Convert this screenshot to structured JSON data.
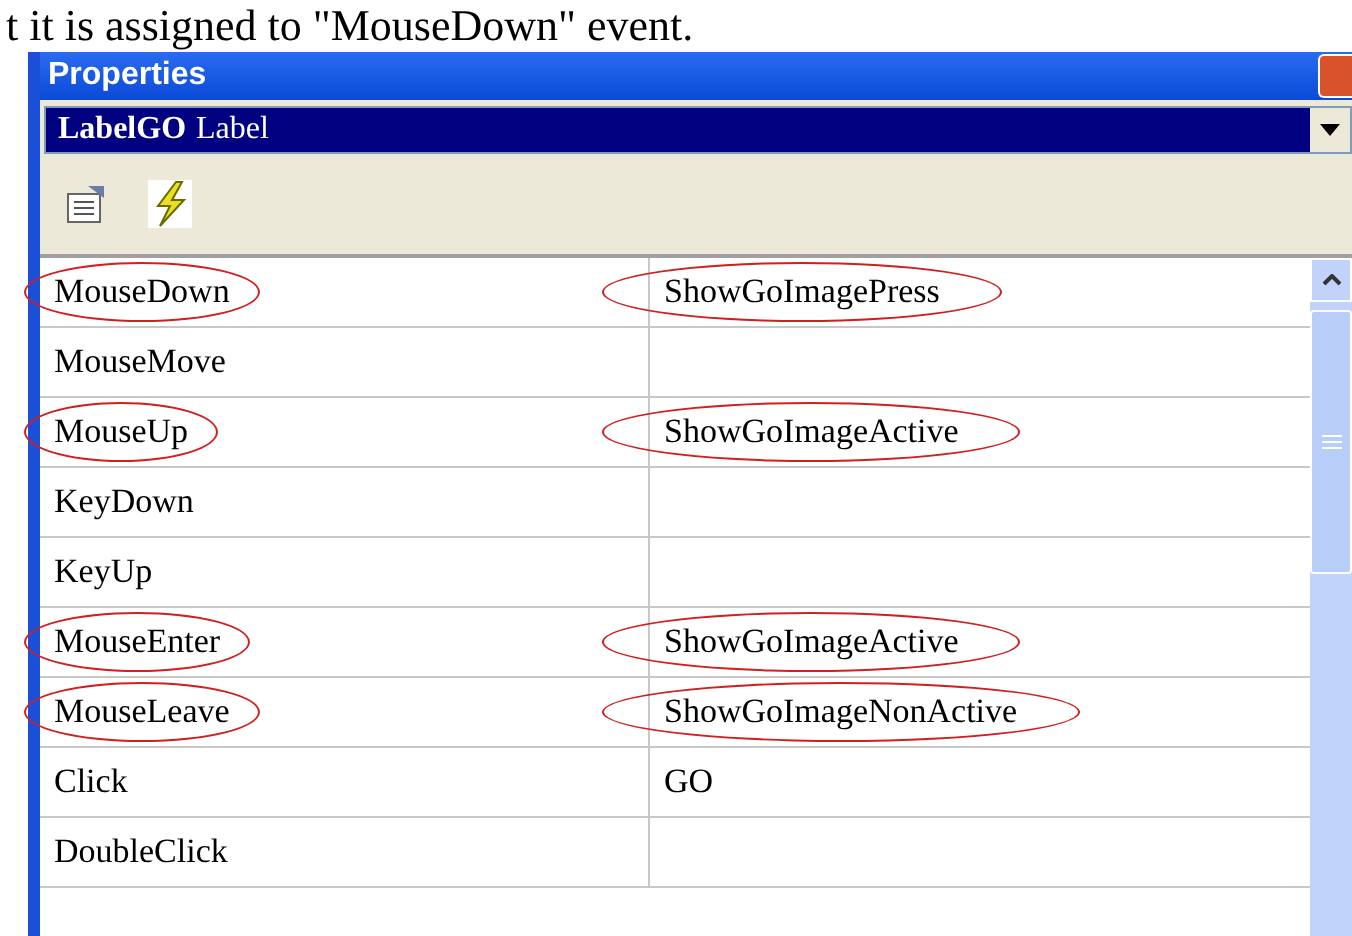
{
  "caption": "t it is assigned to \"MouseDown\" event.",
  "window": {
    "title": "Properties"
  },
  "object_selector": {
    "name": "LabelGO",
    "type": "Label"
  },
  "events": [
    {
      "name": "MouseDown",
      "value": "ShowGoImagePress",
      "circled": true
    },
    {
      "name": "MouseMove",
      "circled": false
    },
    {
      "name": "MouseUp",
      "value": "ShowGoImageActive",
      "circled": true
    },
    {
      "name": "KeyDown",
      "circled": false
    },
    {
      "name": "KeyUp",
      "circled": false
    },
    {
      "name": "MouseEnter",
      "value": "ShowGoImageActive",
      "circled": true
    },
    {
      "name": "MouseLeave",
      "value": "ShowGoImageNonActive",
      "circled": true
    },
    {
      "name": "Click",
      "value": "GO",
      "circled": false
    },
    {
      "name": "DoubleClick",
      "circled": false
    }
  ]
}
